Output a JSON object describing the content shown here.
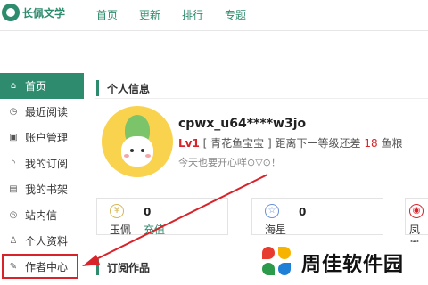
{
  "brand": {
    "name": "长佩文学"
  },
  "topnav": [
    "首页",
    "更新",
    "排行",
    "专题"
  ],
  "sidebar": {
    "items": [
      {
        "label": "首页",
        "icon": "home-icon"
      },
      {
        "label": "最近阅读",
        "icon": "clock-icon"
      },
      {
        "label": "账户管理",
        "icon": "account-icon"
      },
      {
        "label": "我的订阅",
        "icon": "rss-icon"
      },
      {
        "label": "我的书架",
        "icon": "bookshelf-icon"
      },
      {
        "label": "站内信",
        "icon": "message-icon"
      },
      {
        "label": "个人资料",
        "icon": "user-icon"
      },
      {
        "label": "作者中心",
        "icon": "pen-icon"
      }
    ]
  },
  "profile": {
    "section_title": "个人信息",
    "username": "cpwx_u64****w3jo",
    "level": "Lv1",
    "rank_text": "[ 青花鱼宝宝 ]",
    "next_level_text": "距离下一等级还差",
    "fish_needed": "18",
    "fish_unit": "鱼粮",
    "motto": "今天也要开心咩⊙▽⊙！"
  },
  "stats": [
    {
      "name": "玉佩",
      "value": "0",
      "link": "充值",
      "icon": "jade-icon"
    },
    {
      "name": "海星",
      "value": "0",
      "link": "",
      "icon": "starfish-icon"
    },
    {
      "name": "凤凰",
      "value": "",
      "link": "",
      "icon": "phoenix-icon"
    }
  ],
  "works": {
    "section_title": "订阅作品"
  },
  "watermark": {
    "text": "周佳软件园"
  },
  "colors": {
    "accent": "#2e8b6e",
    "highlight": "#d8232a",
    "gold": "#d7b65a"
  }
}
